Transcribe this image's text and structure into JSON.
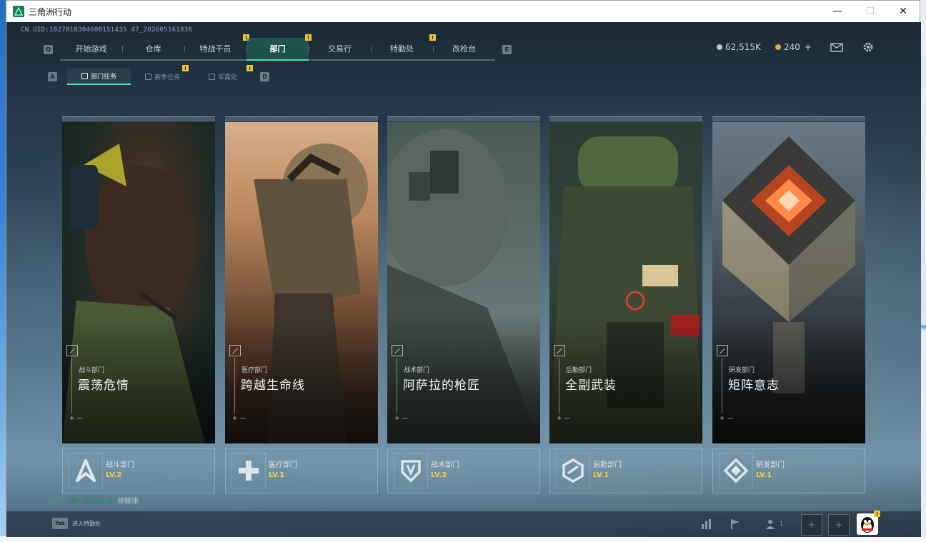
{
  "window": {
    "title": "三角洲行动"
  },
  "uid": "CN UID:1827810304600151435 47_202605161836",
  "nav": {
    "left_key": "Q",
    "right_key": "E",
    "tabs": [
      {
        "label": "开始游戏",
        "badge": ""
      },
      {
        "label": "仓库",
        "badge": ""
      },
      {
        "label": "特战干员",
        "badge": "!"
      },
      {
        "label": "部门",
        "badge": "!",
        "active": true
      },
      {
        "label": "交易行",
        "badge": ""
      },
      {
        "label": "特勤处",
        "badge": "!"
      },
      {
        "label": "改枪台",
        "badge": ""
      }
    ]
  },
  "currency": {
    "silver": "62,515K",
    "gold": "240",
    "gold_add": "+"
  },
  "subnav": {
    "left_key": "A",
    "right_key": "D",
    "tabs": [
      {
        "label": "部门任务",
        "active": true
      },
      {
        "label": "赛季任务",
        "badge": "!"
      },
      {
        "label": "军需处",
        "badge": "!"
      }
    ]
  },
  "departments": [
    {
      "category": "战斗部门",
      "title": "震荡危情",
      "name": "战斗部门",
      "level": "LV.2",
      "icon": "combat-dept-icon"
    },
    {
      "category": "医疗部门",
      "title": "跨越生命线",
      "name": "医疗部门",
      "level": "LV.1",
      "icon": "medical-dept-icon"
    },
    {
      "category": "战术部门",
      "title": "阿萨拉的枪匠",
      "name": "战术部门",
      "level": "LV.2",
      "icon": "tactical-dept-icon"
    },
    {
      "category": "后勤部门",
      "title": "全副武装",
      "name": "后勤部门",
      "level": "LV.1",
      "icon": "logistics-dept-icon"
    },
    {
      "category": "研发部门",
      "title": "矩阵意志",
      "name": "研发部门",
      "level": "LV.1",
      "icon": "research-dept-icon"
    }
  ],
  "chat": {
    "channel": "[世界]",
    "sender": "满心都是杀意:",
    "message": "修脚来"
  },
  "bottom": {
    "tab_key": "Tab",
    "hint": "进入特勤处",
    "team_count": "1"
  },
  "colors": {
    "accent": "#4ee0a8",
    "level": "#f0d04c",
    "badge": "#f1c232"
  }
}
